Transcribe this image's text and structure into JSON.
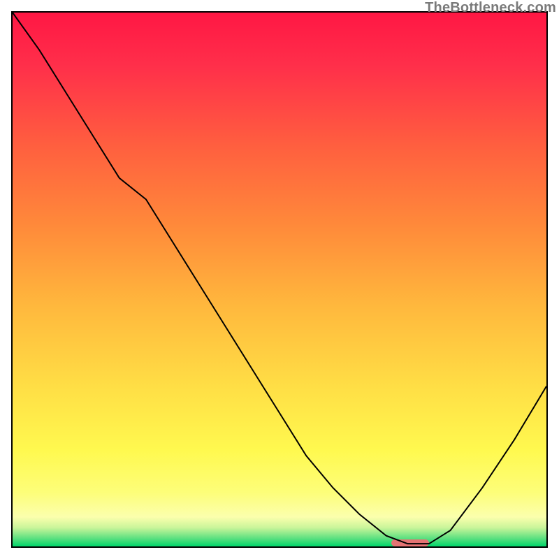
{
  "watermark": "TheBottleneck.com",
  "colors": {
    "gradient_stops": [
      {
        "offset": 0.0,
        "color": "#ff1744"
      },
      {
        "offset": 0.1,
        "color": "#ff2f4a"
      },
      {
        "offset": 0.25,
        "color": "#ff5f3f"
      },
      {
        "offset": 0.4,
        "color": "#ff8a3a"
      },
      {
        "offset": 0.55,
        "color": "#ffb83d"
      },
      {
        "offset": 0.7,
        "color": "#ffde45"
      },
      {
        "offset": 0.82,
        "color": "#fff94f"
      },
      {
        "offset": 0.9,
        "color": "#fdfe7a"
      },
      {
        "offset": 0.945,
        "color": "#fbffad"
      },
      {
        "offset": 0.965,
        "color": "#c9f59a"
      },
      {
        "offset": 0.985,
        "color": "#5be080"
      },
      {
        "offset": 1.0,
        "color": "#00d66a"
      }
    ],
    "curve": "#000000",
    "marker": "#e57373",
    "frame": "#000000"
  },
  "chart_data": {
    "type": "line",
    "title": "",
    "xlabel": "",
    "ylabel": "",
    "xlim": [
      0,
      100
    ],
    "ylim": [
      0,
      100
    ],
    "series": [
      {
        "name": "bottleneck-curve",
        "x": [
          0,
          5,
          10,
          15,
          20,
          25,
          30,
          35,
          40,
          45,
          50,
          55,
          60,
          65,
          70,
          74,
          76,
          78,
          82,
          88,
          94,
          100
        ],
        "y": [
          100,
          93,
          85,
          77,
          69,
          65,
          57,
          49,
          41,
          33,
          25,
          17,
          11,
          6,
          2,
          0.5,
          0.5,
          0.5,
          3,
          11,
          20,
          30
        ]
      }
    ],
    "marker": {
      "x_start": 71,
      "x_end": 78,
      "y": 0.5
    }
  }
}
